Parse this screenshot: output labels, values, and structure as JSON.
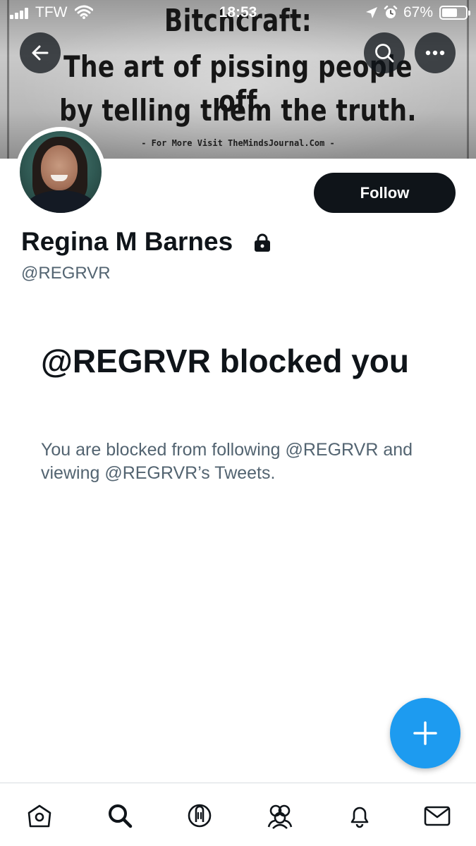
{
  "status_bar": {
    "carrier": "TFW",
    "time": "18:53",
    "battery_percent": "67%",
    "battery_level": 0.67,
    "icons": [
      "signal-icon",
      "wifi-icon",
      "location-icon",
      "alarm-icon",
      "battery-icon"
    ]
  },
  "header": {
    "banner_lines": [
      "Bitchcraft:",
      "The art of pissing people off",
      "by telling them the truth."
    ],
    "banner_credit": "- For More Visit TheMindsJournal.Com -",
    "buttons": [
      "back-arrow-icon",
      "search-icon",
      "more-icon"
    ]
  },
  "profile": {
    "display_name": "Regina M Barnes",
    "handle": "@REGRVR",
    "protected_icon": "lock-icon",
    "follow_label": "Follow"
  },
  "blocked_notice": {
    "title": "@REGRVR blocked you",
    "description": "You are blocked from following @REGRVR and viewing @REGRVR’s Tweets."
  },
  "fab": {
    "icon": "plus-icon"
  },
  "tabbar": {
    "items": [
      "home-icon",
      "search-icon",
      "spaces-icon",
      "communities-icon",
      "notifications-icon",
      "messages-icon"
    ],
    "active": "search-icon"
  },
  "colors": {
    "text_primary": "#0f1419",
    "text_secondary": "#536471",
    "accent": "#1d9bf0",
    "follow_button": "#0f1419"
  }
}
